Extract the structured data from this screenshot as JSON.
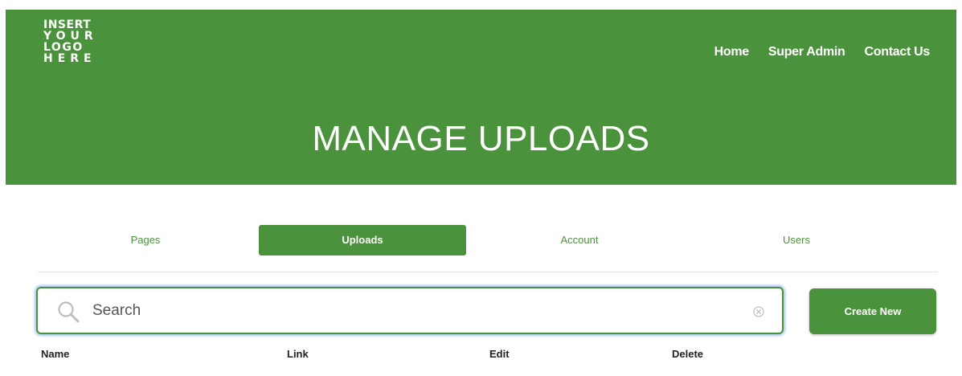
{
  "logo": {
    "lines": [
      "INSERT",
      "YOUR",
      "LOGO",
      "HERE"
    ]
  },
  "nav": {
    "items": [
      {
        "label": "Home"
      },
      {
        "label": "Super Admin"
      },
      {
        "label": "Contact Us"
      }
    ]
  },
  "page_title": "MANAGE UPLOADS",
  "tabs": [
    {
      "label": "Pages",
      "active": false
    },
    {
      "label": "Uploads",
      "active": true
    },
    {
      "label": "Account",
      "active": false
    },
    {
      "label": "Users",
      "active": false
    }
  ],
  "search": {
    "placeholder": "Search",
    "value": ""
  },
  "create_button": {
    "label": "Create New"
  },
  "table": {
    "columns": [
      "Name",
      "Link",
      "Edit",
      "Delete"
    ]
  },
  "colors": {
    "accent": "#4b923c",
    "focus_ring": "#a9c6ea",
    "text": "#222222"
  },
  "icons": {
    "search": "search-icon",
    "clear": "clear-icon"
  }
}
